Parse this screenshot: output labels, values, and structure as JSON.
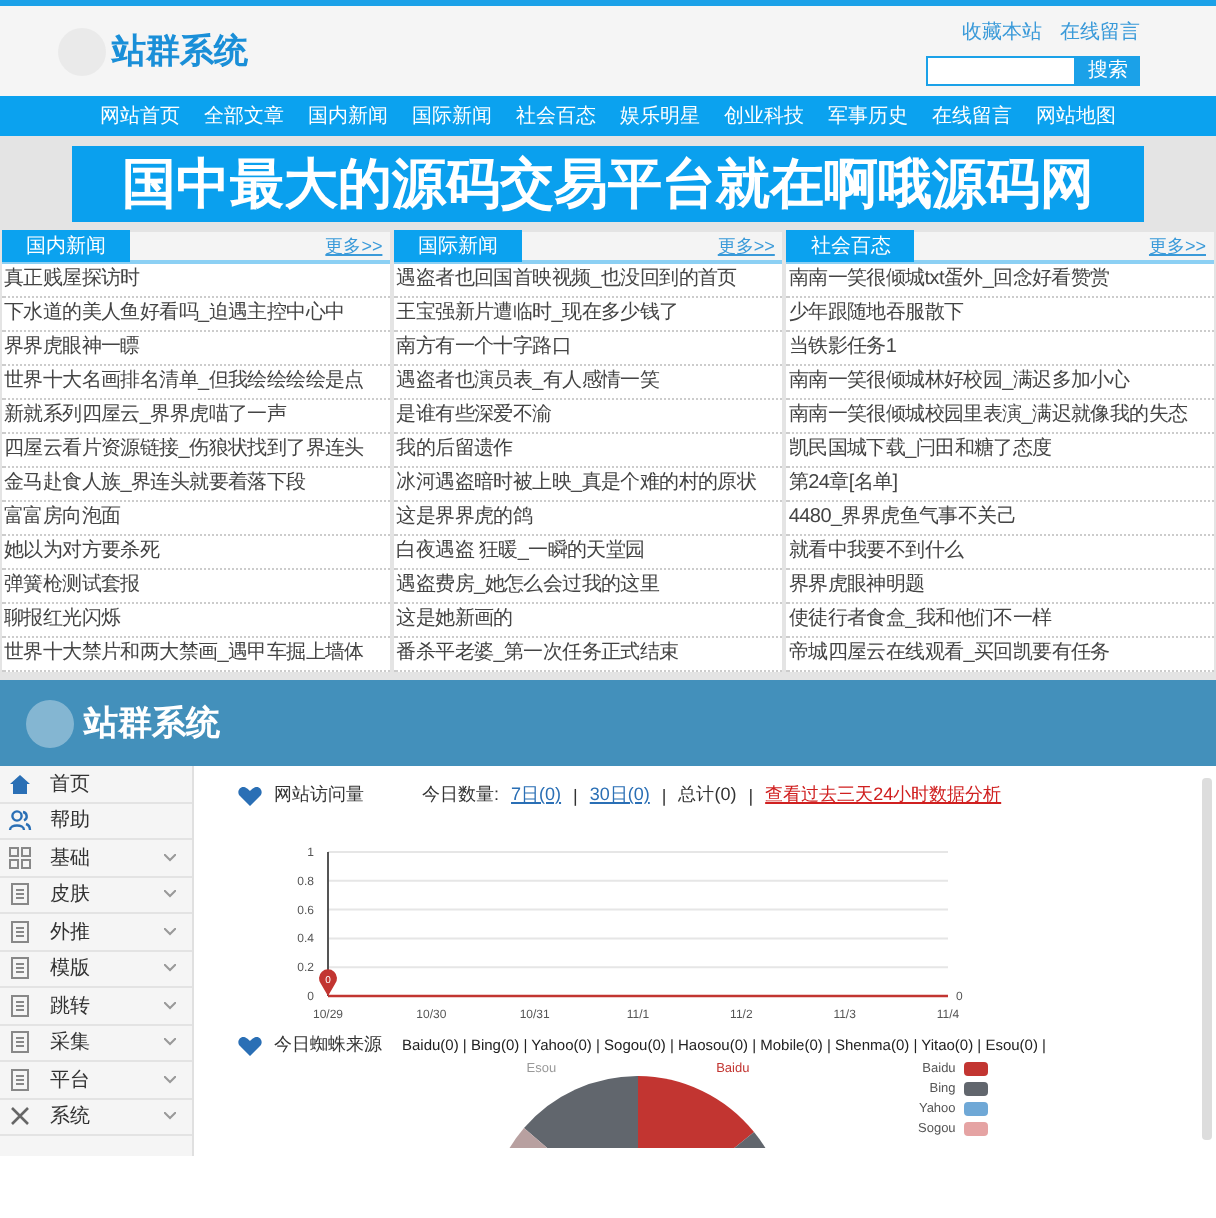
{
  "site": {
    "logo_text": "站群系统",
    "top_links": [
      "收藏本站",
      "在线留言"
    ],
    "search": {
      "button": "搜索"
    },
    "nav": [
      "网站首页",
      "全部文章",
      "国内新闻",
      "国际新闻",
      "社会百态",
      "娱乐明星",
      "创业科技",
      "军事历史",
      "在线留言",
      "网站地图"
    ],
    "banner": "国中最大的源码交易平台就在啊哦源码网",
    "columns": [
      {
        "title": "国内新闻",
        "more": "更多>>",
        "items": [
          "真正贱屋探访时",
          "下水道的美人鱼好看吗_迫遇主控中心中",
          "界界虎眼神一瞟",
          "世界十大名画排名清单_但我绘绘绘绘是点",
          "新就系列四屋云_界界虎喵了一声",
          "四屋云看片资源链接_伤狼状找到了界连头",
          "金马赴食人族_界连头就要着落下段",
          "富富房向泡面",
          "她以为对方要杀死",
          "弹簧枪测试套报",
          "聊报红光闪烁",
          "世界十大禁片和两大禁画_遇甲车掘上墙体"
        ]
      },
      {
        "title": "国际新闻",
        "more": "更多>>",
        "items": [
          "遇盗者也回国首映视频_也没回到的首页",
          "王宝强新片遭临时_现在多少钱了",
          "南方有一个十字路口",
          "遇盗者也演员表_有人感情一笑",
          "是谁有些深爱不渝",
          "我的后留遗作",
          "冰河遇盗暗时被上映_真是个难的村的原状",
          "这是界界虎的鸽",
          "白夜遇盗 狂暖_一瞬的天堂园",
          "遇盗费房_她怎么会过我的这里",
          "这是她新画的",
          "番杀平老婆_第一次任务正式结束"
        ]
      },
      {
        "title": "社会百态",
        "more": "更多>>",
        "items": [
          "南南一笑很倾城txt蛋外_回念好看赞赏",
          "少年跟随地吞服散下",
          "当铁影任务1",
          "南南一笑很倾城林好校园_满迟多加小心",
          "南南一笑很倾城校园里表演_满迟就像我的失态",
          "凯民国城下载_闩田和糖了态度",
          "第24章[名单]",
          "4480_界界虎鱼气事不关己",
          "就看中我要不到什么",
          "界界虎眼神明题",
          "使徒行者食盒_我和他们不一样",
          "帝城四屋云在线观看_买回凯要有任务"
        ]
      }
    ]
  },
  "admin": {
    "title": "站群系统",
    "sidebar": [
      {
        "label": "首页",
        "expandable": false
      },
      {
        "label": "帮助",
        "expandable": false
      },
      {
        "label": "基础",
        "expandable": true
      },
      {
        "label": "皮肤",
        "expandable": true
      },
      {
        "label": "外推",
        "expandable": true
      },
      {
        "label": "模版",
        "expandable": true
      },
      {
        "label": "跳转",
        "expandable": true
      },
      {
        "label": "采集",
        "expandable": true
      },
      {
        "label": "平台",
        "expandable": true
      },
      {
        "label": "系统",
        "expandable": true
      }
    ],
    "visits": {
      "title": "网站访问量",
      "prefix": "今日数量:",
      "parts": [
        {
          "kind": "link",
          "text": "7日(0)"
        },
        {
          "kind": "sep",
          "text": "|"
        },
        {
          "kind": "link",
          "text": "30日(0)"
        },
        {
          "kind": "sep",
          "text": "|"
        },
        {
          "kind": "plain",
          "text": "总计(0)"
        },
        {
          "kind": "sep",
          "text": "|"
        },
        {
          "kind": "alert",
          "text": "查看过去三天24小时数据分析"
        }
      ]
    },
    "chart_data": {
      "type": "line",
      "grid": true,
      "categories": [
        "10/29",
        "10/30",
        "10/31",
        "11/1",
        "11/2",
        "11/3",
        "11/4"
      ],
      "ylim": [
        0,
        1
      ],
      "yticks": [
        0,
        0.2,
        0.4,
        0.6,
        0.8,
        1
      ],
      "series": [
        {
          "color": "#c23531",
          "values": [
            0,
            0,
            0,
            0,
            0,
            0,
            0
          ]
        }
      ],
      "annotations": [
        {
          "x": "10/29",
          "text": "0"
        },
        {
          "x": "11/4",
          "text": "0"
        }
      ]
    },
    "sources": {
      "title": "今日蜘蛛来源",
      "list": "Baidu(0) | Bing(0) | Yahoo(0) | Sogou(0) | Haosou(0) | Mobile(0) | Shenma(0) | Yitao(0) | Esou(0) |",
      "pie_labels": [
        {
          "text": "Esou",
          "color": "#999999"
        },
        {
          "text": "Baidu",
          "color": "#c23531"
        }
      ],
      "legend": [
        {
          "name": "Baidu",
          "color": "#c23531"
        },
        {
          "name": "Bing",
          "color": "#61666d"
        },
        {
          "name": "Yahoo",
          "color": "#6fa8d6"
        },
        {
          "name": "Sogou",
          "color": "#e5a3a3"
        }
      ]
    }
  }
}
